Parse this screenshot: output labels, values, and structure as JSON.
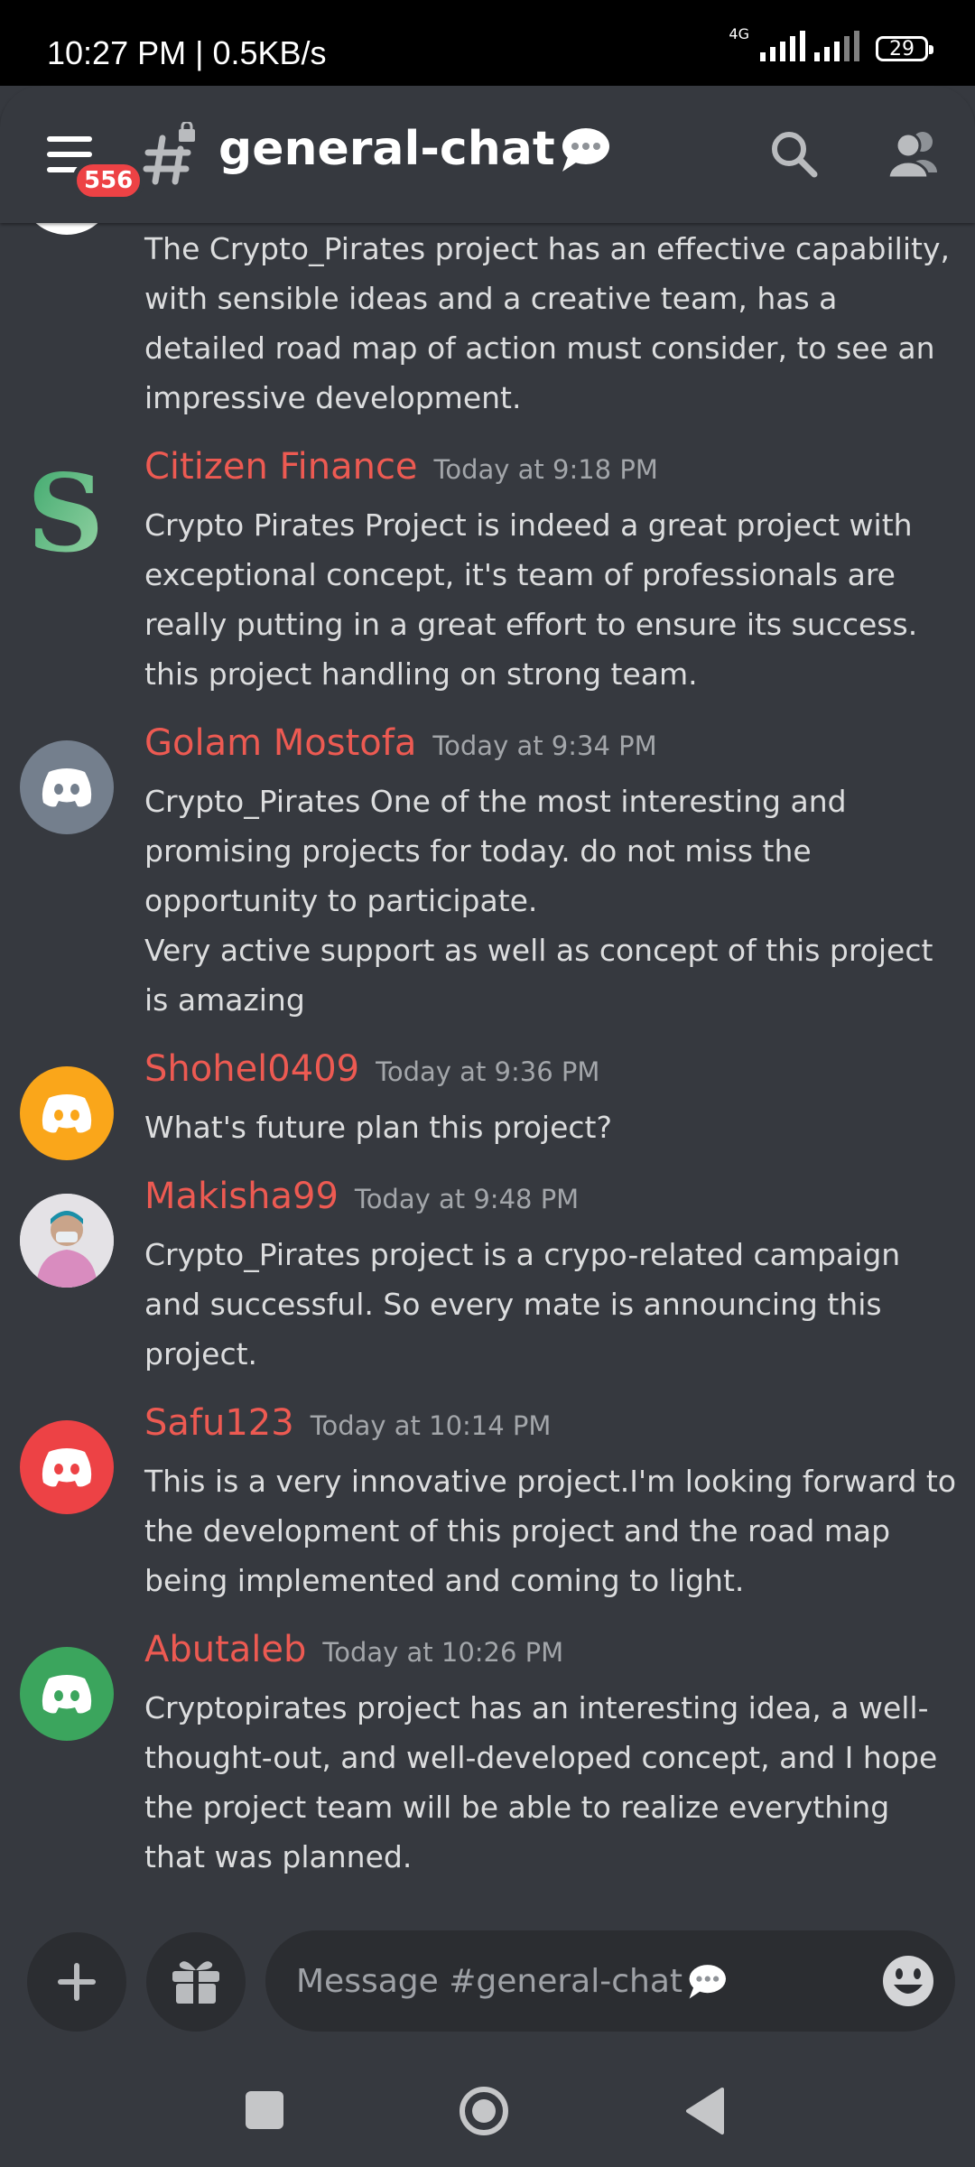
{
  "status_bar": {
    "time": "10:27 PM | 0.5KB/s",
    "network": "4G",
    "battery": "29"
  },
  "header": {
    "unread_badge": "556",
    "channel_name": "general-chat",
    "icons": [
      "menu-icon",
      "locked-channel-hash-icon",
      "speech-bubble-icon",
      "search-icon",
      "members-icon"
    ]
  },
  "messages": [
    {
      "author": "",
      "timestamp": "",
      "avatar": "nvg-logo",
      "lines": [
        "The Crypto_Pirates project has an effective capability, with sensible ideas and a creative team, has a detailed road map of action must consider, to see an impressive development."
      ]
    },
    {
      "author": "Citizen Finance",
      "timestamp": "Today at 9:18 PM",
      "avatar": "green-s-logo",
      "lines": [
        "Crypto Pirates Project is indeed a great project with exceptional concept, it's team of professionals are really putting in a great effort to ensure its success. this project handling on strong team."
      ]
    },
    {
      "author": "Golam Mostofa",
      "timestamp": "Today at 9:34 PM",
      "avatar": "discord-gray",
      "lines": [
        "Crypto_Pirates One of the most interesting and promising projects for today. do not miss the opportunity to participate.",
        "Very active support as well as concept of this project is amazing"
      ]
    },
    {
      "author": "Shohel0409",
      "timestamp": "Today at 9:36 PM",
      "avatar": "discord-yellow",
      "lines": [
        "What's future plan this project?"
      ]
    },
    {
      "author": "Makisha99",
      "timestamp": "Today at 9:48 PM",
      "avatar": "photo",
      "lines": [
        "Crypto_Pirates project is a crypo-related campaign and successful. So every mate is announcing this project."
      ]
    },
    {
      "author": "Safu123",
      "timestamp": "Today at 10:14 PM",
      "avatar": "discord-red",
      "lines": [
        "This is a very innovative project.I'm looking forward to the development of this project and the road map being implemented and coming to light."
      ]
    },
    {
      "author": "Abutaleb",
      "timestamp": "Today at 10:26 PM",
      "avatar": "discord-green",
      "lines": [
        "Cryptopirates project has an interesting idea, a well-thought-out, and well-developed concept, and I hope the project team will be able to realize everything that was planned."
      ]
    }
  ],
  "composer": {
    "placeholder": "Message #general-chat",
    "icons": [
      "plus-icon",
      "gift-icon",
      "speech-bubble-icon",
      "emoji-icon"
    ]
  },
  "colors": {
    "background": "#36393f",
    "author_name": "#ed5a52",
    "badge": "#ed4245",
    "discord_gray": "#747f8d",
    "discord_yellow": "#faa61a",
    "discord_red": "#ed4245",
    "discord_green": "#3ba55d"
  }
}
